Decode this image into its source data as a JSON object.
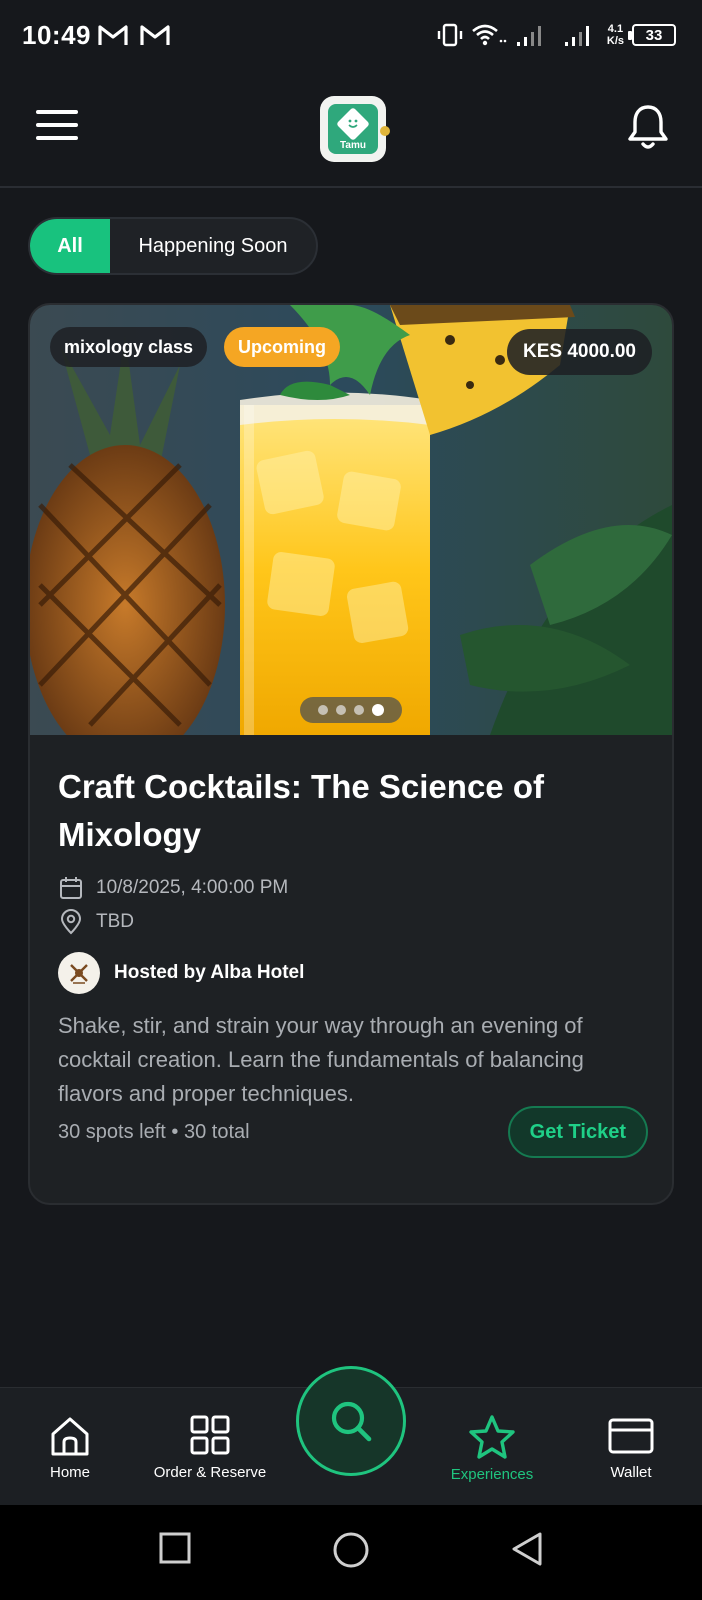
{
  "status_bar": {
    "time": "10:49",
    "net_speed_value": "4.1",
    "net_speed_unit": "K/s",
    "battery": "33"
  },
  "header": {
    "logo_text": "Tamu"
  },
  "filters": [
    {
      "label": "All",
      "active": true
    },
    {
      "label": "Happening Soon",
      "active": false
    }
  ],
  "event": {
    "category": "mixology class",
    "status": "Upcoming",
    "price": "KES 4000.00",
    "carousel": {
      "count": 4,
      "active_index": 3
    },
    "title": "Craft Cocktails: The Science of Mixology",
    "datetime": "10/8/2025, 4:00:00 PM",
    "location": "TBD",
    "host": "Hosted by Alba Hotel",
    "description": "Shake, stir, and strain your way through an evening of cocktail creation. Learn the fundamentals of balancing flavors and proper techniques.",
    "spots": "30 spots left • 30 total",
    "cta": "Get Ticket"
  },
  "bottom_nav": {
    "items": [
      {
        "label": "Home",
        "icon": "home-icon"
      },
      {
        "label": "Order & Reserve",
        "icon": "grid-icon"
      },
      {
        "label": "Experiences",
        "icon": "star-icon",
        "active": true
      },
      {
        "label": "Wallet",
        "icon": "wallet-icon"
      }
    ],
    "fab_icon": "search-icon"
  },
  "colors": {
    "accent": "#1fc47f",
    "status_upcoming": "#f5a623",
    "background": "#16181c",
    "card": "#1e2124"
  }
}
